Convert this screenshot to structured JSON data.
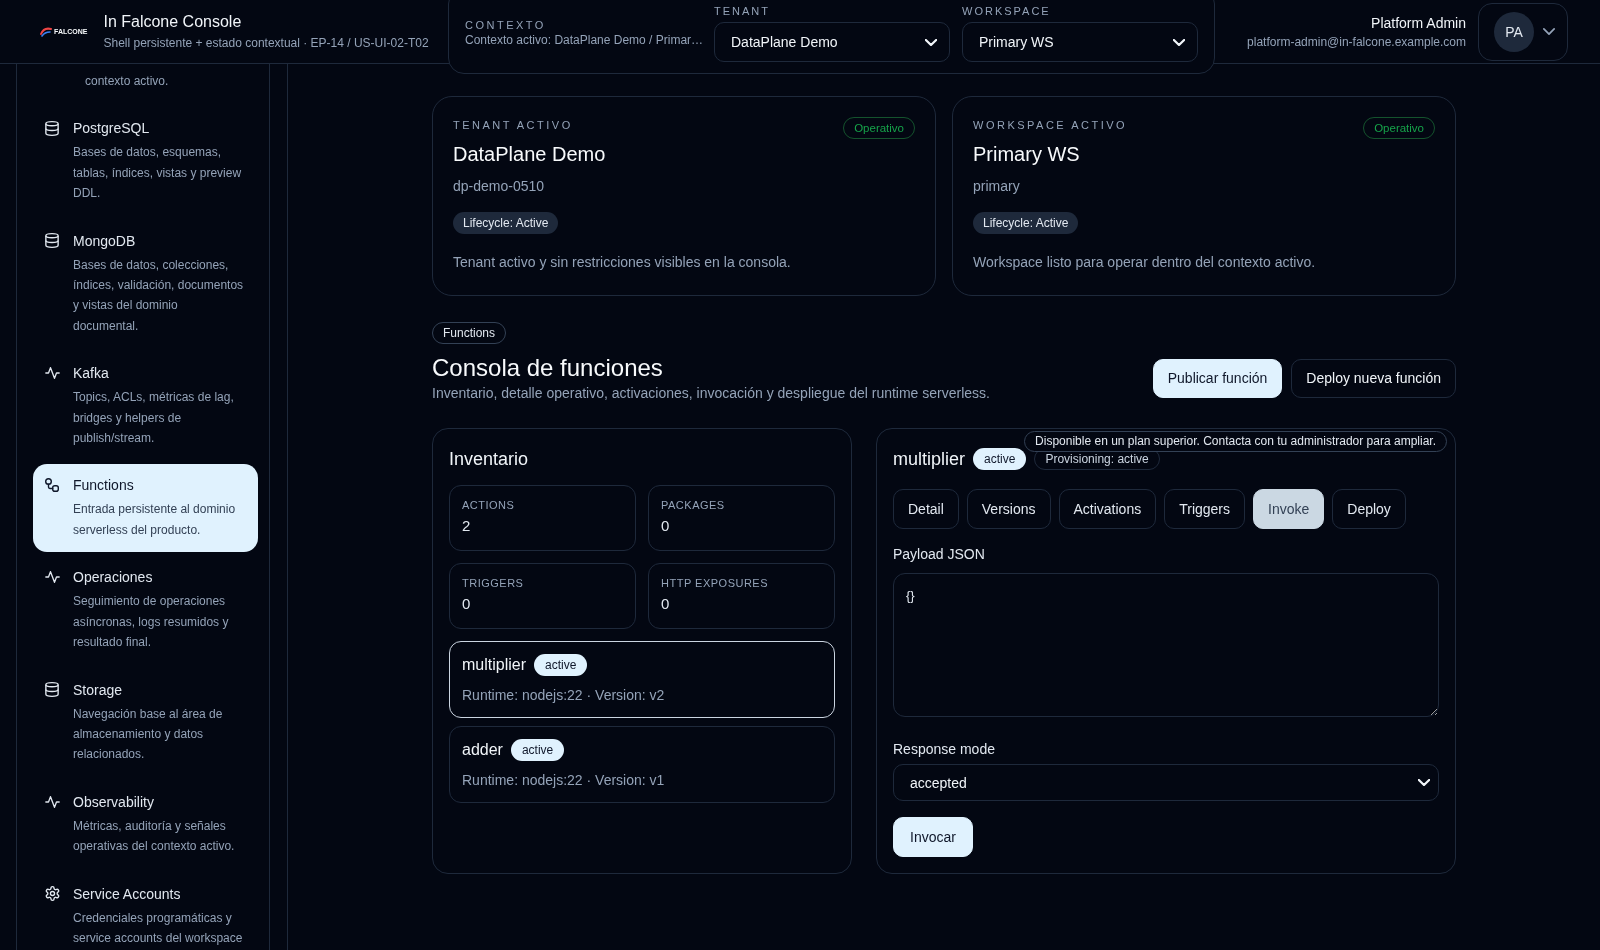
{
  "header": {
    "logo_text": "FALCONE",
    "title": "In Falcone Console",
    "subtitle": "Shell persistente + estado contextual · EP-14 / US-UI-02-T02"
  },
  "context": {
    "label": "CONTEXTO",
    "summary": "Contexto activo: DataPlane Demo / Primar…",
    "selectors": [
      {
        "label": "TENANT",
        "value": "DataPlane Demo"
      },
      {
        "label": "WORKSPACE",
        "value": "Primary WS"
      }
    ]
  },
  "user": {
    "name": "Platform Admin",
    "email": "platform-admin@in-falcone.example.com",
    "initials": "PA"
  },
  "sidebar": {
    "cut_text": "contexto activo.",
    "items": [
      {
        "kind": "database",
        "title": "PostgreSQL",
        "description": "Bases de datos, esquemas, tablas, índices, vistas y preview DDL.",
        "selected": false
      },
      {
        "kind": "database",
        "title": "MongoDB",
        "description": "Bases de datos, colecciones, índices, validación, documentos y vistas del dominio documental.",
        "selected": false
      },
      {
        "kind": "pulse",
        "title": "Kafka",
        "description": "Topics, ACLs, métricas de lag, bridges y helpers de publish/stream.",
        "selected": false
      },
      {
        "kind": "nodes",
        "title": "Functions",
        "description": "Entrada persistente al dominio serverless del producto.",
        "selected": true
      },
      {
        "kind": "pulse",
        "title": "Operaciones",
        "description": "Seguimiento de operaciones asíncronas, logs resumidos y resultado final.",
        "selected": false
      },
      {
        "kind": "database",
        "title": "Storage",
        "description": "Navegación base al área de almacenamiento y datos relacionados.",
        "selected": false
      },
      {
        "kind": "pulse",
        "title": "Observability",
        "description": "Métricas, auditoría y señales operativas del contexto activo.",
        "selected": false
      },
      {
        "kind": "gear",
        "title": "Service Accounts",
        "description": "Credenciales programáticas y service accounts del workspace",
        "selected": false
      }
    ]
  },
  "active_cards": [
    {
      "label": "TENANT ACTIVO",
      "status": "Operativo",
      "name": "DataPlane Demo",
      "slug": "dp-demo-0510",
      "lifecycle": "Lifecycle: Active",
      "description": "Tenant activo y sin restricciones visibles en la consola."
    },
    {
      "label": "WORKSPACE ACTIVO",
      "status": "Operativo",
      "name": "Primary WS",
      "slug": "primary",
      "lifecycle": "Lifecycle: Active",
      "description": "Workspace listo para operar dentro del contexto activo."
    }
  ],
  "functions": {
    "tag": "Functions",
    "title": "Consola de funciones",
    "subtitle": "Inventario, detalle operativo, activaciones, invocación y despliegue del runtime serverless.",
    "actions": [
      {
        "label": "Publicar función",
        "primary": true
      },
      {
        "label": "Deploy nueva función",
        "primary": false
      }
    ]
  },
  "inventory": {
    "title": "Inventario",
    "stats": [
      {
        "label": "ACTIONS",
        "value": "2"
      },
      {
        "label": "PACKAGES",
        "value": "0"
      },
      {
        "label": "TRIGGERS",
        "value": "0"
      },
      {
        "label": "HTTP EXPOSURES",
        "value": "0"
      }
    ],
    "items": [
      {
        "name": "multiplier",
        "status": "active",
        "meta": "Runtime: nodejs:22 · Version: v2",
        "selected": true
      },
      {
        "name": "adder",
        "status": "active",
        "meta": "Runtime: nodejs:22 · Version: v1",
        "selected": false
      }
    ]
  },
  "detail": {
    "name": "multiplier",
    "status": "active",
    "provisioning": "Provisioning: active",
    "tooltip": "Disponible en un plan superior. Contacta con tu administrador para ampliar.",
    "tabs": [
      {
        "label": "Detail",
        "selected": false
      },
      {
        "label": "Versions",
        "selected": false
      },
      {
        "label": "Activations",
        "selected": false
      },
      {
        "label": "Triggers",
        "selected": false
      },
      {
        "label": "Invoke",
        "selected": true
      },
      {
        "label": "Deploy",
        "selected": false
      }
    ],
    "payload": {
      "label": "Payload JSON",
      "value": "{}"
    },
    "response_mode": {
      "label": "Response mode",
      "value": "accepted"
    },
    "submit": "Invocar"
  }
}
